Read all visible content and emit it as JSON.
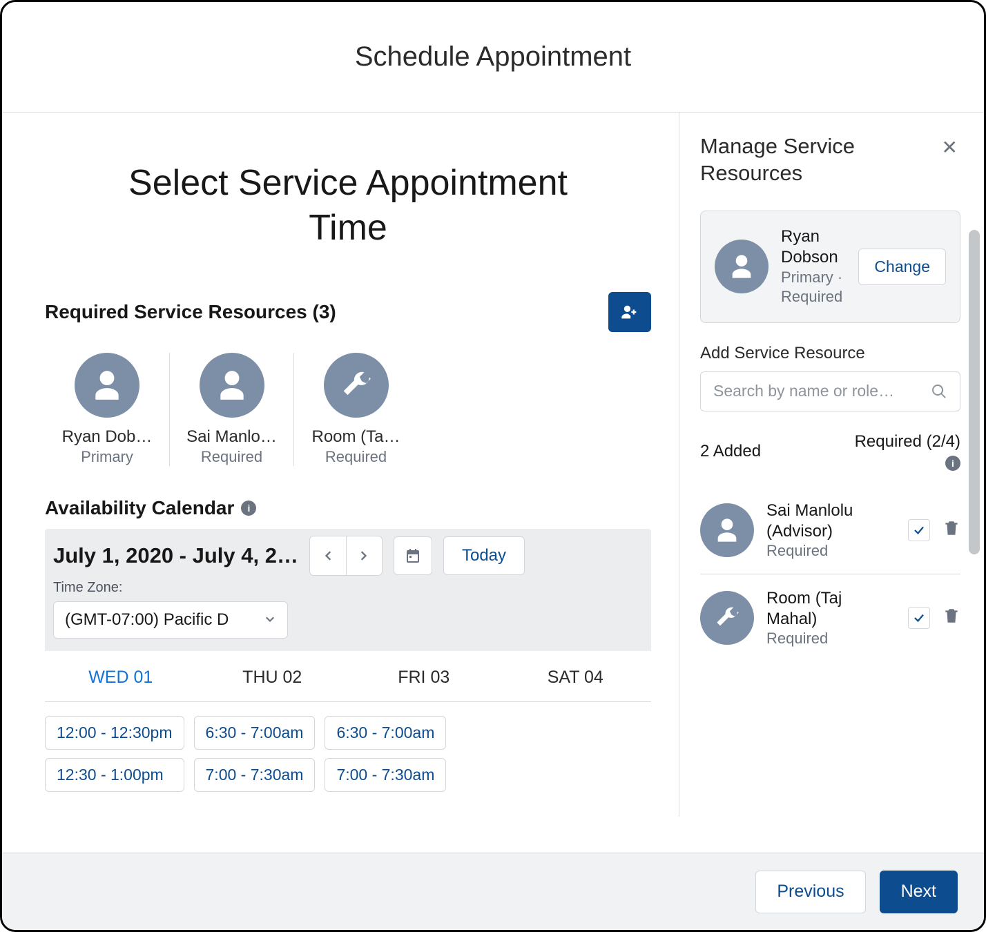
{
  "header": {
    "title": "Schedule Appointment"
  },
  "main": {
    "page_title": "Select Service Appointment Time",
    "section_label": "Required Service Resources (3)",
    "resources": [
      {
        "name": "Ryan Dob…",
        "role": "Primary",
        "icon": "person"
      },
      {
        "name": "Sai Manlo…",
        "role": "Required",
        "icon": "person"
      },
      {
        "name": "Room (Ta…",
        "role": "Required",
        "icon": "wrench"
      }
    ],
    "availability_label": "Availability Calendar",
    "date_range": "July 1, 2020 - July 4, 2…",
    "today_label": "Today",
    "timezone_label": "Time Zone:",
    "timezone_value": "(GMT-07:00) Pacific D",
    "days": [
      {
        "label": "WED 01",
        "active": true
      },
      {
        "label": "THU 02",
        "active": false
      },
      {
        "label": "FRI 03",
        "active": false
      },
      {
        "label": "SAT 04",
        "active": false
      }
    ],
    "slot_columns": [
      [
        "12:00 - 12:30pm",
        "12:30 - 1:00pm"
      ],
      [
        "6:30 - 7:00am",
        "7:00 - 7:30am"
      ],
      [
        "6:30 - 7:00am",
        "7:00 - 7:30am"
      ]
    ]
  },
  "panel": {
    "title": "Manage Service Resources",
    "primary": {
      "name": "Ryan Dobson",
      "sub": "Primary · Required",
      "change_label": "Change"
    },
    "add_label": "Add Service Resource",
    "search_placeholder": "Search by name or role…",
    "added_count_label": "2 Added",
    "required_count_label": "Required (2/4)",
    "added": [
      {
        "name": "Sai Manlolu (Advisor)",
        "sub": "Required",
        "icon": "person",
        "checked": true
      },
      {
        "name": "Room (Taj Mahal)",
        "sub": "Required",
        "icon": "wrench",
        "checked": true
      }
    ]
  },
  "footer": {
    "previous_label": "Previous",
    "next_label": "Next"
  }
}
